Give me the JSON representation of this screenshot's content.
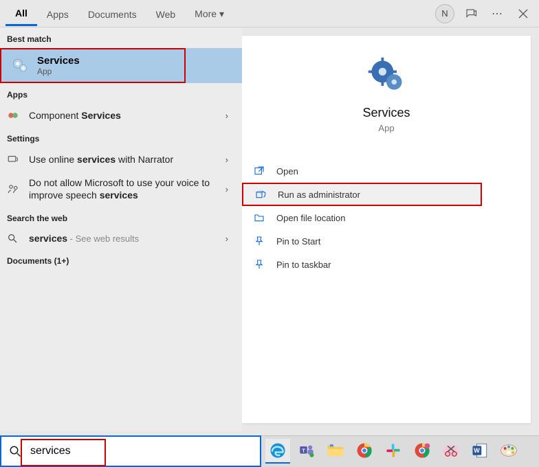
{
  "tabs": {
    "all": "All",
    "apps": "Apps",
    "documents": "Documents",
    "web": "Web",
    "more": "More"
  },
  "user_initial": "N",
  "left": {
    "best_match_header": "Best match",
    "best_match": {
      "title": "Services",
      "subtitle": "App"
    },
    "apps_header": "Apps",
    "apps_row": {
      "prefix": "Component ",
      "hl": "Services"
    },
    "settings_header": "Settings",
    "settings_rows": [
      {
        "pre": "Use online ",
        "hl": "services",
        "post": " with Narrator"
      },
      {
        "pre": "Do not allow Microsoft to use your voice to improve speech ",
        "hl": "services",
        "post": ""
      }
    ],
    "search_web_header": "Search the web",
    "web_row": {
      "hl": "services",
      "tail": " - See web results"
    },
    "documents_header": "Documents (1+)"
  },
  "right": {
    "title": "Services",
    "subtitle": "App",
    "actions": {
      "open": "Open",
      "run_admin": "Run as administrator",
      "open_loc": "Open file location",
      "pin_start": "Pin to Start",
      "pin_taskbar": "Pin to taskbar"
    }
  },
  "search": {
    "value": "services"
  },
  "taskbar_icons": [
    "edge",
    "teams",
    "explorer",
    "chrome",
    "slack",
    "chrome2",
    "snip",
    "word",
    "paint"
  ]
}
